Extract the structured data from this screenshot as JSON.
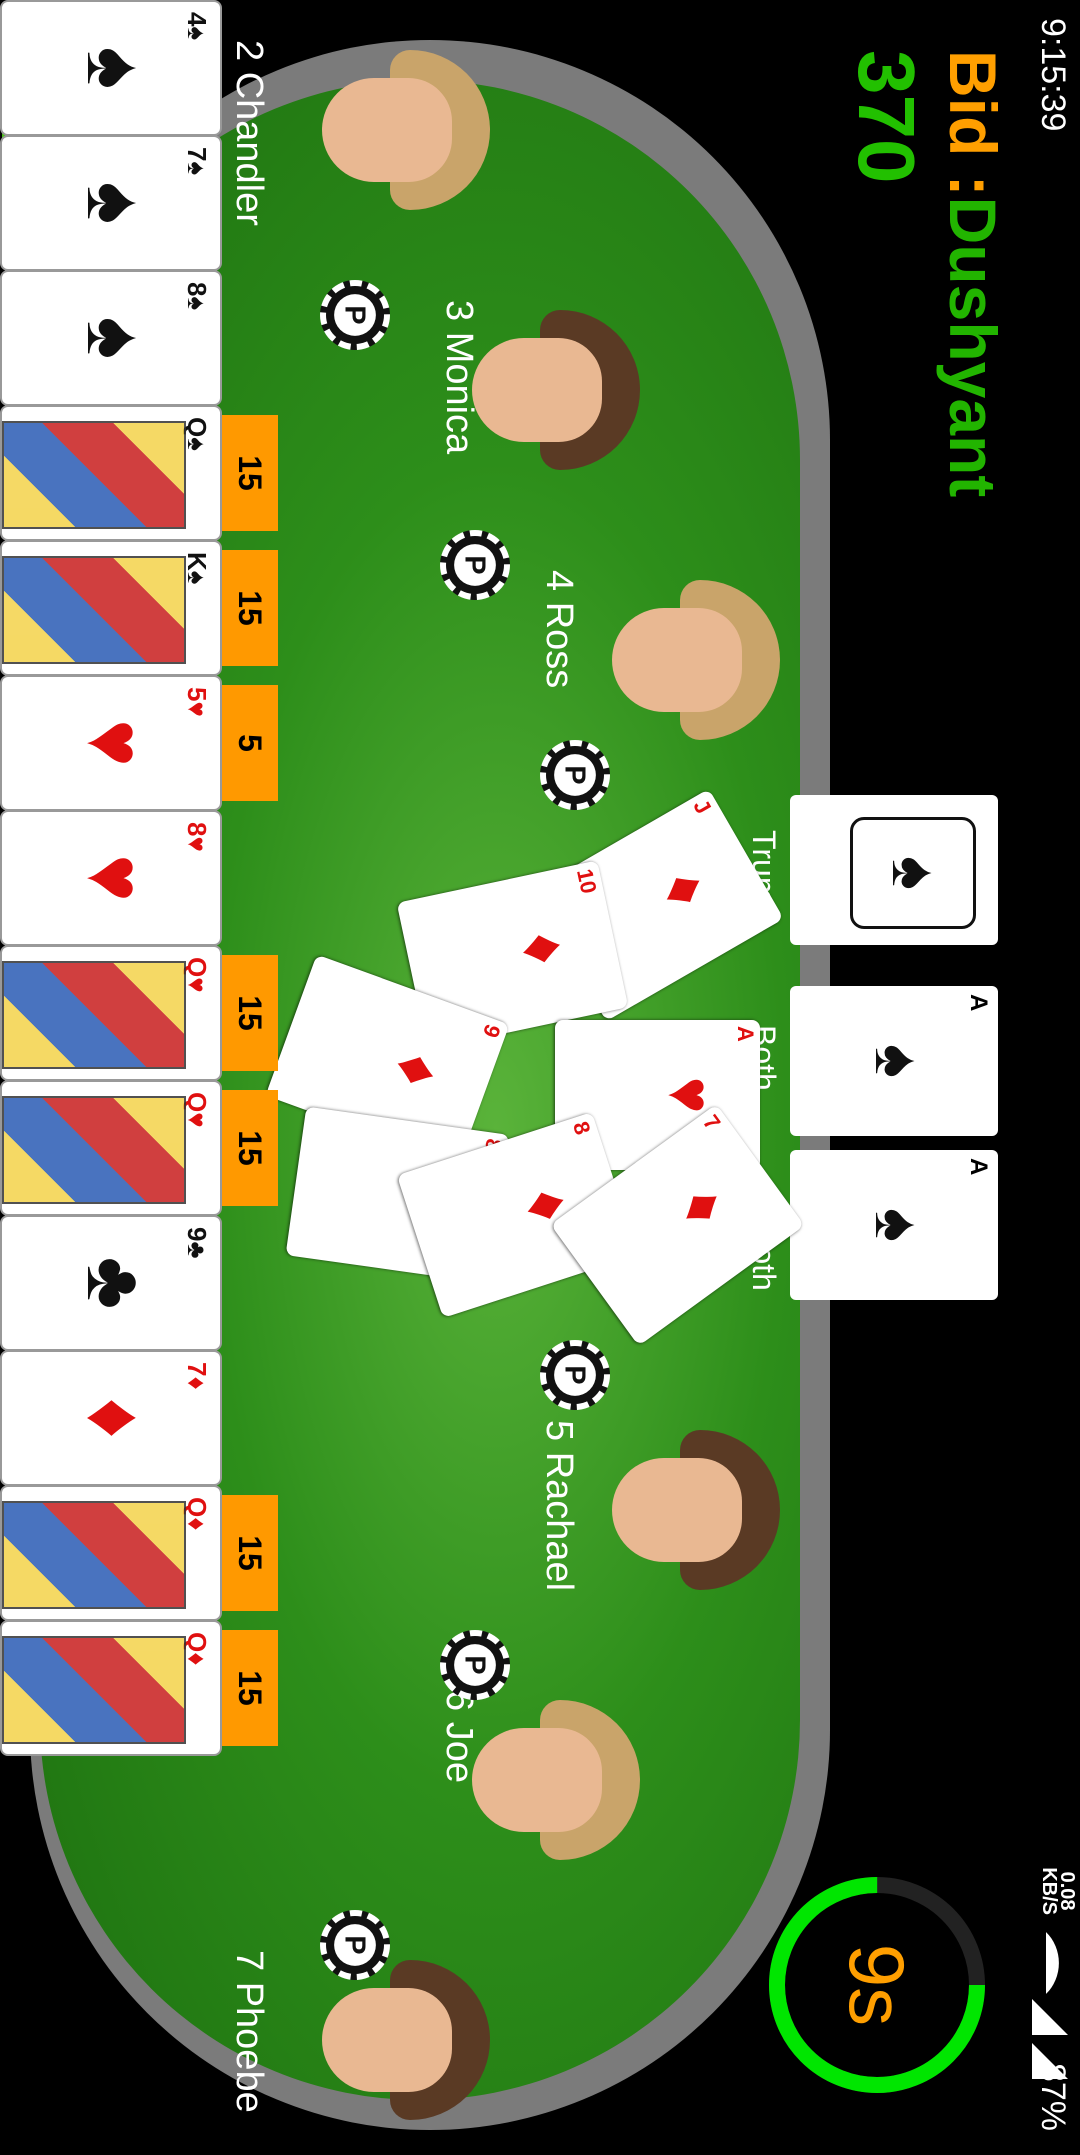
{
  "status_bar": {
    "time": "9:15:39",
    "net_speed_value": "0.08",
    "net_speed_unit": "KB/S",
    "battery": "87%"
  },
  "bid": {
    "label": "Bid :",
    "bidder": "Dushyant",
    "amount": "370"
  },
  "timer": {
    "label": "9s",
    "fraction_remaining": 0.75
  },
  "players": [
    {
      "label": "2 Chandler"
    },
    {
      "label": "3 Monica"
    },
    {
      "label": "4 Ross"
    },
    {
      "label": "5 Rachael"
    },
    {
      "label": "6 Joe"
    },
    {
      "label": "7 Phoebe"
    }
  ],
  "chip_text": "P",
  "trump": {
    "label": "Trump",
    "suit_icon": "spade-icon"
  },
  "partner_cards": [
    {
      "label": "Both",
      "rank": "A",
      "suit": "♠"
    },
    {
      "label": "Both",
      "rank": "A",
      "suit": "♠"
    }
  ],
  "table_cards": [
    {
      "rank": "J",
      "suit": "♦"
    },
    {
      "rank": "10",
      "suit": "♦"
    },
    {
      "rank": "9",
      "suit": "♦"
    },
    {
      "rank": "A",
      "suit": "♥"
    },
    {
      "rank": "8",
      "suit": "♦"
    },
    {
      "rank": "8",
      "suit": "♦"
    },
    {
      "rank": "7",
      "suit": "♦"
    }
  ],
  "hand": [
    {
      "rank": "4",
      "suit": "♠",
      "points": ""
    },
    {
      "rank": "7",
      "suit": "♠",
      "points": ""
    },
    {
      "rank": "8",
      "suit": "♠",
      "points": ""
    },
    {
      "rank": "Q",
      "suit": "♠",
      "points": "15"
    },
    {
      "rank": "K",
      "suit": "♠",
      "points": "15"
    },
    {
      "rank": "5",
      "suit": "♥",
      "points": "5"
    },
    {
      "rank": "8",
      "suit": "♥",
      "points": ""
    },
    {
      "rank": "Q",
      "suit": "♥",
      "points": "15"
    },
    {
      "rank": "Q",
      "suit": "♥",
      "points": "15"
    },
    {
      "rank": "9",
      "suit": "♣",
      "points": ""
    },
    {
      "rank": "7",
      "suit": "♦",
      "points": ""
    },
    {
      "rank": "Q",
      "suit": "♦",
      "points": "15"
    },
    {
      "rank": "Q",
      "suit": "♦",
      "points": "15"
    }
  ],
  "colors": {
    "felt": "#2d8e1a",
    "accent_orange": "#ff9f00",
    "accent_green": "#22b400",
    "points_badge": "#ff9900",
    "timer_ring": "#00e600"
  }
}
